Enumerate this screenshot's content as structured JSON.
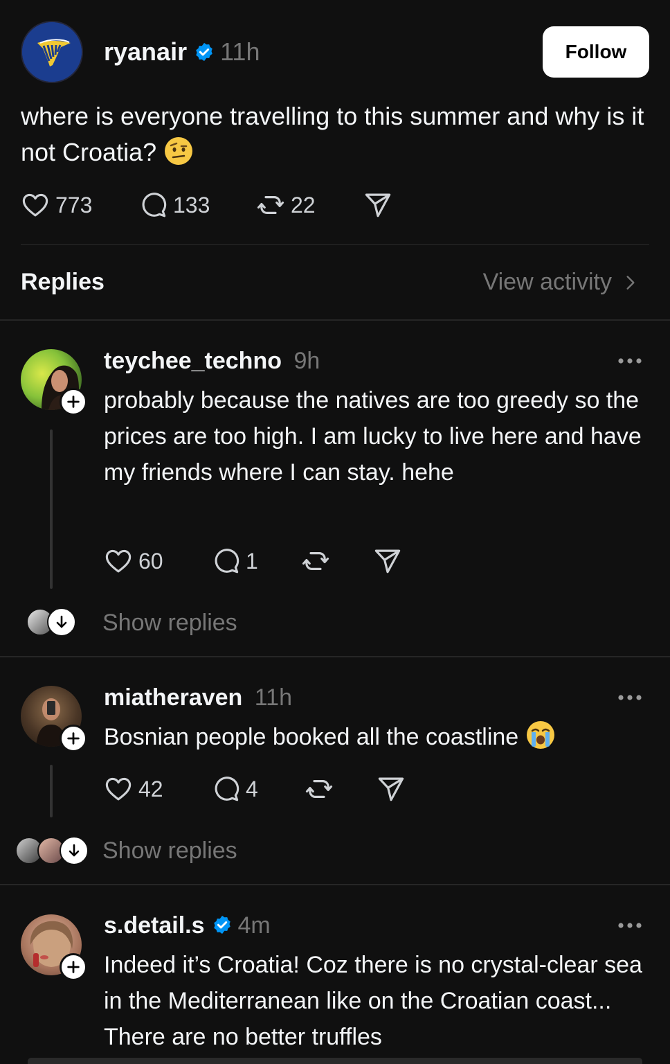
{
  "post": {
    "username": "ryanair",
    "timestamp": "11h",
    "follow_label": "Follow",
    "text": "where is everyone travelling to this summer and why is it not Croatia?",
    "emoji_icon": "face-with-raised-eyebrow-emoji",
    "likes": "773",
    "comments": "133",
    "reposts": "22"
  },
  "replies_section": {
    "title": "Replies",
    "view_activity": "View activity"
  },
  "replies": [
    {
      "username": "teychee_techno",
      "timestamp": "9h",
      "text": "probably because the natives are too greedy so the prices are too high. I am lucky to live here and have my friends where I can stay. hehe",
      "likes": "60",
      "comments": "1",
      "show_replies": "Show replies"
    },
    {
      "username": "miatheraven",
      "timestamp": "11h",
      "text": "Bosnian people booked all the coastline",
      "emoji_icon": "loudly-crying-face-emoji",
      "likes": "42",
      "comments": "4",
      "show_replies": "Show replies"
    },
    {
      "username": "s.detail.s",
      "timestamp": "4m",
      "text": "Indeed it’s Croatia! Coz there is no crystal-clear sea in the Mediterranean like on the Croatian coast... There are no better truffles"
    }
  ],
  "colors": {
    "background": "#101010",
    "text": "#f3f5f7",
    "muted": "#777777",
    "verified": "#0095f6",
    "brand_navy": "#1b3d8f",
    "brand_gold": "#f1c933"
  }
}
